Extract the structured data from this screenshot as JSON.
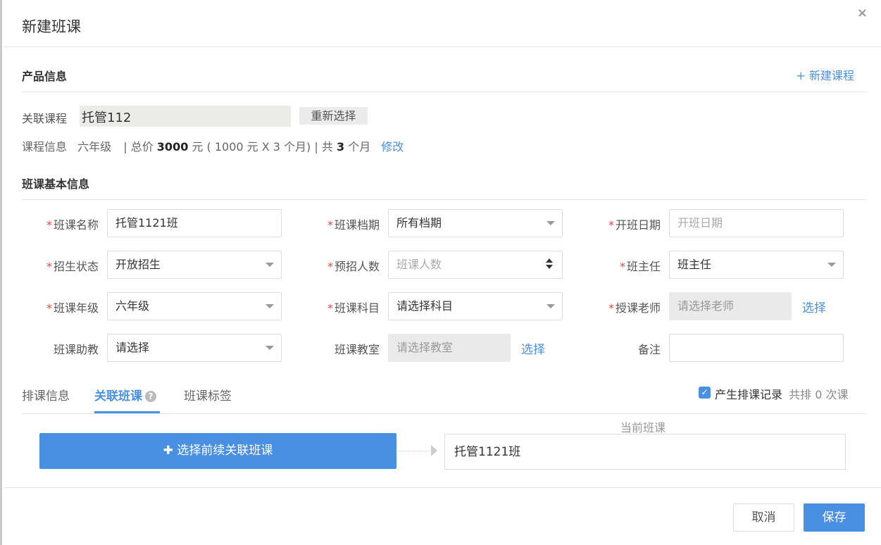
{
  "modal": {
    "title": "新建班课",
    "close_glyph": "×"
  },
  "product": {
    "section_title": "产品信息",
    "new_course_link": "+ 新建课程",
    "linked_course_label": "关联课程",
    "linked_course_value": "托管112",
    "reselect_label": "重新选择",
    "course_info_label": "课程信息",
    "grade": "六年级",
    "total_prefix": "| 总价",
    "total_amount": "3000",
    "total_detail": "元 ( 1000 元 X 3 个月) | 共",
    "months": "3",
    "months_unit": "个月",
    "edit_link": "修改"
  },
  "basic": {
    "section_title": "班课基本信息",
    "fields": {
      "class_name": {
        "label": "班课名称",
        "value": "托管1121班"
      },
      "term": {
        "label": "班课档期",
        "value": "所有档期"
      },
      "start_date": {
        "label": "开班日期",
        "placeholder": "开班日期"
      },
      "enroll_status": {
        "label": "招生状态",
        "value": "开放招生"
      },
      "planned_count": {
        "label": "预招人数",
        "placeholder": "班课人数"
      },
      "head_teacher": {
        "label": "班主任",
        "value": "班主任"
      },
      "grade": {
        "label": "班课年级",
        "value": "六年级"
      },
      "subject": {
        "label": "班课科目",
        "value": "请选择科目"
      },
      "teacher": {
        "label": "授课老师",
        "placeholder": "请选择老师",
        "select_link": "选择"
      },
      "assistant": {
        "label": "班课助教",
        "value": "请选择"
      },
      "classroom": {
        "label": "班课教室",
        "placeholder": "请选择教室",
        "select_link": "选择"
      },
      "remark": {
        "label": "备注",
        "value": ""
      }
    }
  },
  "tabs": [
    {
      "label": "排课信息"
    },
    {
      "label": "关联班课",
      "help": "?"
    },
    {
      "label": "班课标签"
    }
  ],
  "schedule_record": {
    "checked_glyph": "✓",
    "label": "产生排课记录",
    "count_text": "共排 0 次课"
  },
  "linked": {
    "select_button": "✚ 选择前续关联班课",
    "current_caption": "当前班课",
    "current_value": "托管1121班"
  },
  "footer": {
    "cancel": "取消",
    "save": "保存"
  },
  "colors": {
    "accent": "#4a90e2",
    "required": "#e44444"
  }
}
